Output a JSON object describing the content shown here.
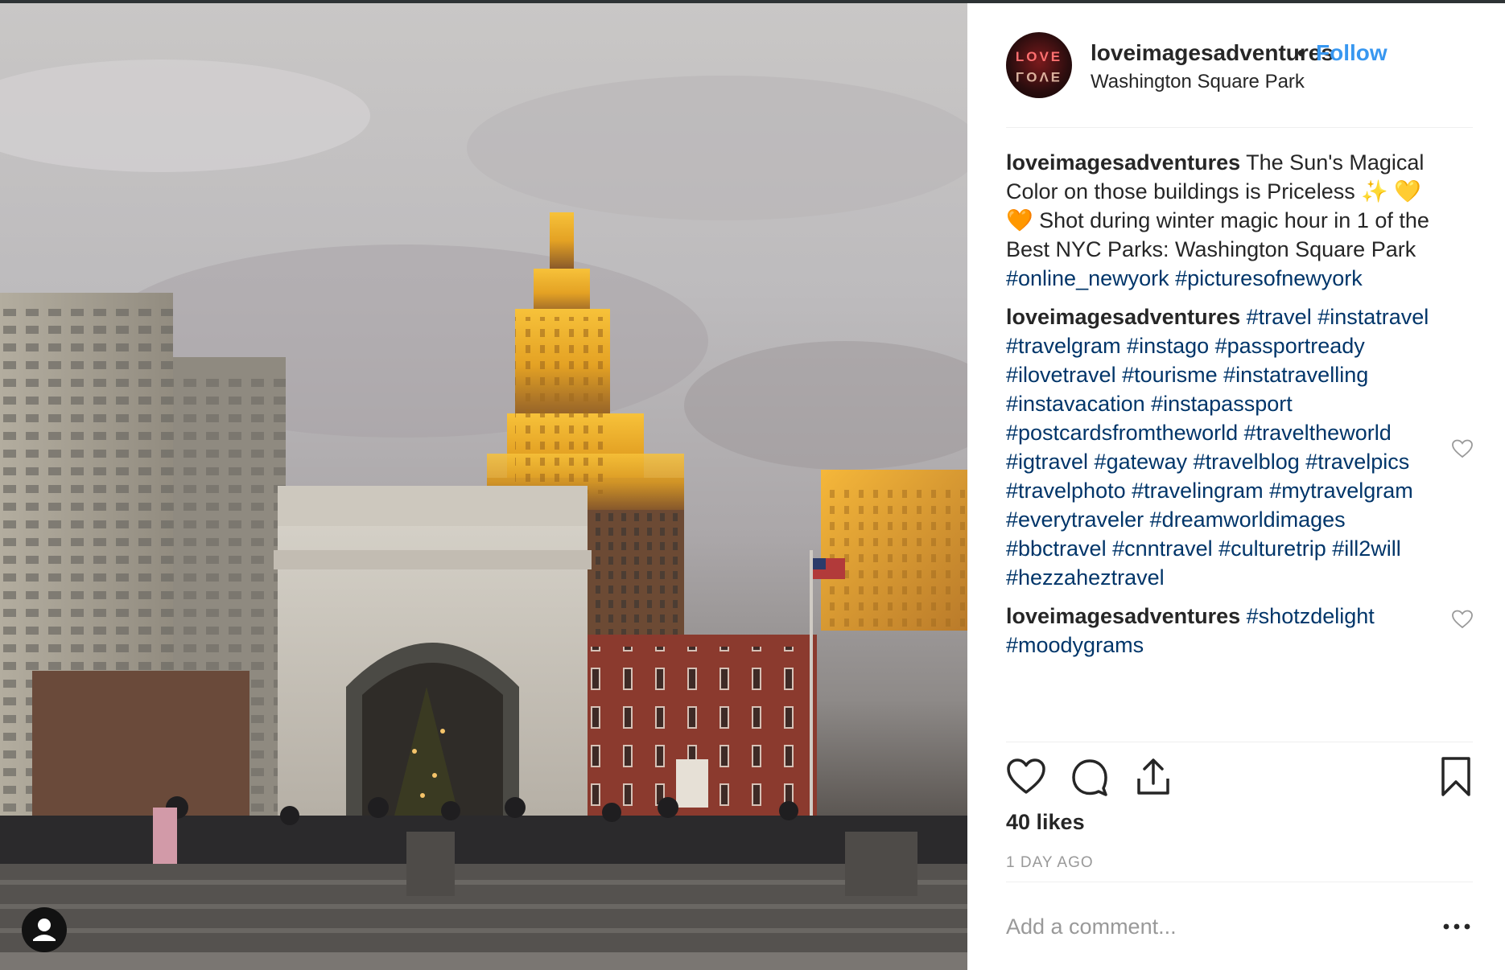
{
  "post": {
    "photo": {
      "description_icon": "photo-user-tag-icon"
    },
    "header": {
      "username": "loveimagesadventures",
      "separator": "•",
      "follow_label": "Follow",
      "location": "Washington Square Park",
      "avatar_text": [
        "LOVE",
        "LOVE"
      ]
    },
    "comments": [
      {
        "user": "loveimagesadventures",
        "text": " The Sun's Magical Color on those buildings is Priceless ✨ 💛 🧡  Shot during winter magic hour in 1 of the Best NYC Parks: Washington Square Park ",
        "tags": "#online_newyork #picturesofnewyork",
        "has_like": false
      },
      {
        "user": "loveimagesadventures",
        "text": " ",
        "tags": "#travel #instatravel #travelgram #instago #passportready #ilovetravel #tourisme #instatravelling #instavacation #instapassport #postcardsfromtheworld #traveltheworld #igtravel #gateway #travelblog #travelpics #travelphoto #travelingram #mytravelgram #everytraveler #dreamworldimages #bbctravel #cnntravel #culturetrip #ill2will #hezzaheztravel",
        "has_like": true
      },
      {
        "user": "loveimagesadventures",
        "text": " ",
        "tags": "#shotzdelight #moodygrams",
        "has_like": true
      }
    ],
    "likes": "40 likes",
    "timestamp": "1 DAY AGO",
    "comment_placeholder": "Add a comment...",
    "more_label": "•••"
  },
  "colors": {
    "follow": "#3897f0",
    "hashtag": "#003569",
    "muted": "#999999",
    "text": "#262626"
  }
}
